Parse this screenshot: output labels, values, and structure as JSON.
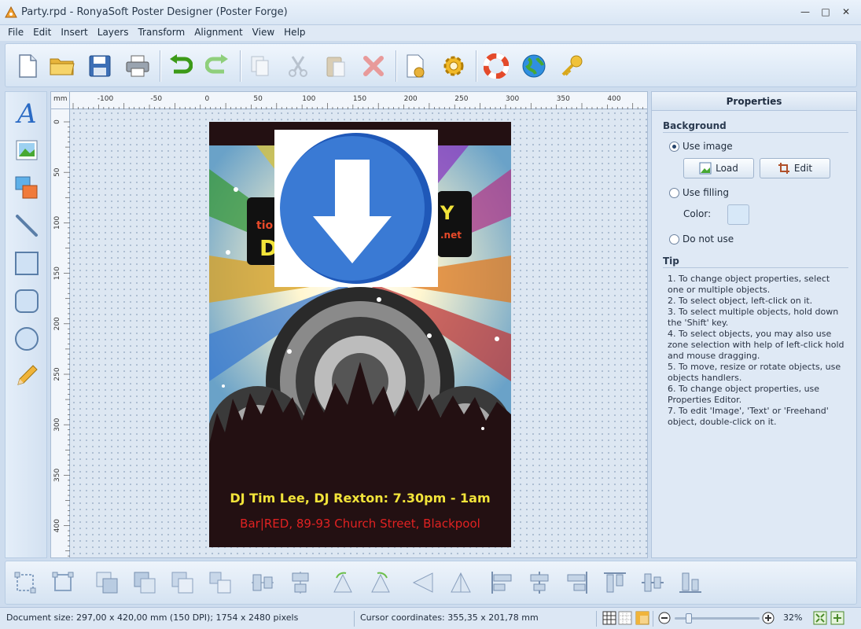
{
  "window": {
    "title": "Party.rpd - RonyaSoft Poster Designer (Poster Forge)"
  },
  "menu": [
    "File",
    "Edit",
    "Insert",
    "Layers",
    "Transform",
    "Alignment",
    "View",
    "Help"
  ],
  "ruler": {
    "unit": "mm",
    "h_labels": [
      "-100",
      "-50",
      "0",
      "50",
      "100",
      "150",
      "200",
      "250",
      "300",
      "350",
      "400"
    ],
    "v_labels": [
      "0",
      "50",
      "100",
      "150",
      "200",
      "250",
      "300",
      "350",
      "400"
    ]
  },
  "poster": {
    "line1": "DJ Tim Lee, DJ Rexton: 7.30pm - 1am",
    "line2": "Bar|RED, 89-93 Church Street, Blackpool",
    "sign_left": "tio",
    "sign_left2": "D",
    "sign_right": "Y",
    "sign_right2": ".net"
  },
  "properties": {
    "header": "Properties",
    "background_title": "Background",
    "use_image": "Use image",
    "load": "Load",
    "edit": "Edit",
    "use_filling": "Use filling",
    "color_label": "Color:",
    "do_not_use": "Do not use",
    "tip_title": "Tip",
    "tip_text": "1. To change object properties, select one or multiple objects.\n2. To select object, left-click on it.\n3. To select multiple objects, hold down the 'Shift' key.\n4. To select objects, you may also use zone selection with help of left-click hold and mouse dragging.\n5. To move, resize or rotate objects, use objects handlers.\n6. To change object properties, use Properties Editor.\n7. To edit 'Image', 'Text' or 'Freehand' object, double-click on it."
  },
  "status": {
    "document_size": "Document size: 297,00 x 420,00 mm (150 DPI); 1754 x 2480 pixels",
    "cursor": "Cursor coordinates: 355,35 x 201,78 mm",
    "zoom": "32%"
  },
  "colors": {
    "accent": "#2e6fd6",
    "poster_bg": "#231012",
    "poster_yellow": "#f2e43a",
    "poster_red": "#e02222"
  }
}
